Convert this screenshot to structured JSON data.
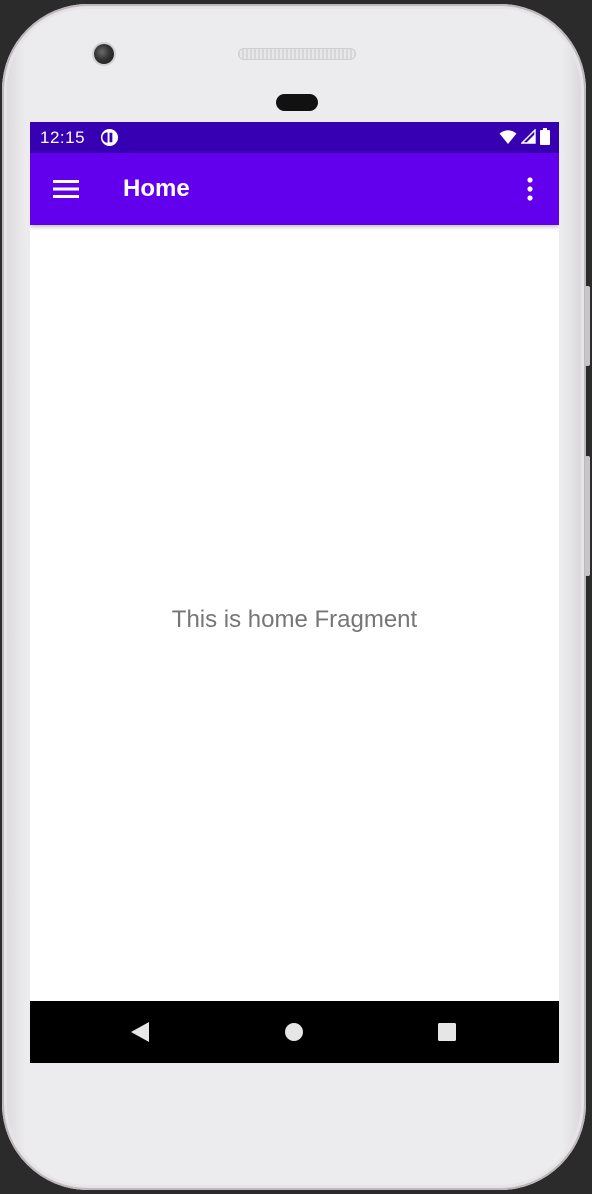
{
  "status_bar": {
    "time": "12:15",
    "notification_icon": "app-notification-icon",
    "wifi_icon": "wifi-icon",
    "signal_icon": "cell-signal-icon",
    "battery_icon": "battery-icon"
  },
  "app_bar": {
    "title": "Home",
    "menu_icon": "hamburger-menu-icon",
    "overflow_icon": "more-vert-icon"
  },
  "content": {
    "message": "This is home Fragment"
  },
  "nav_bar": {
    "back_icon": "back-triangle-icon",
    "home_icon": "home-circle-icon",
    "recents_icon": "recents-square-icon"
  },
  "colors": {
    "status_bar": "#3700b3",
    "app_bar": "#6200ee",
    "nav_bar": "#000000",
    "text": "#767676"
  }
}
